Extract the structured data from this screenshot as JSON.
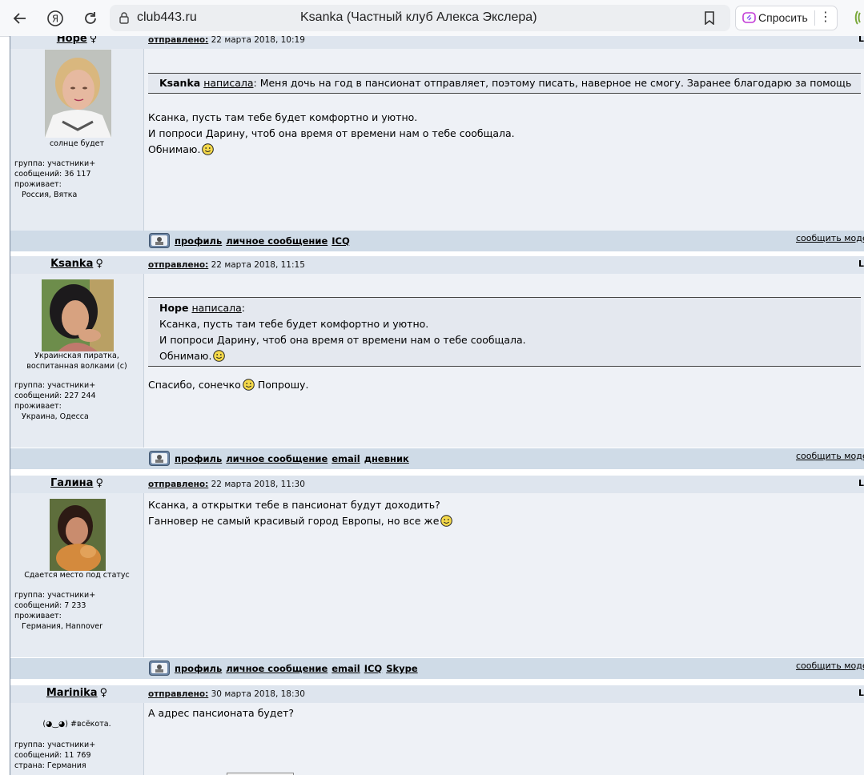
{
  "browser": {
    "url": "club443.ru",
    "page_title": "Ksanka (Частный клуб Алекса Экслера)",
    "ask_label": "Спросить"
  },
  "labels": {
    "sent": "отправлено:",
    "wrote": "написала",
    "report": "сообщить моде",
    "sex_symbol": "♀"
  },
  "posts": [
    {
      "user": "Hope",
      "date": "22 марта 2018, 10:19",
      "status": "солнце будет",
      "info": [
        "группа: участники+",
        "сообщений: 36 117",
        "проживает:",
        "   Россия, Вятка"
      ],
      "quote_author": "Ksanka",
      "quote_lines": [
        "Меня дочь на год в пансионат отправляет, поэтому писать, наверное не смогу. Заранее благодарю за помощь"
      ],
      "lines": [
        "Ксанка, пусть там тебе будет комфортно и уютно.",
        "И попроси Дарину, чтоб она время от времени нам о тебе сообщала.",
        "Обнимаю."
      ],
      "links": [
        "профиль",
        "личное сообщение",
        "ICQ"
      ]
    },
    {
      "user": "Ksanka",
      "date": "22 марта 2018, 11:15",
      "status_lines": [
        "Украинская пиратка,",
        "воспитанная волками (с)"
      ],
      "info": [
        "группа: участники+",
        "сообщений: 227 244",
        "проживает:",
        "   Украина, Одесса"
      ],
      "quote_author": "Hope",
      "quote_lines": [
        "Ксанка, пусть там тебе будет комфортно и уютно.",
        "И попроси Дарину, чтоб она время от времени нам о тебе сообщала.",
        "Обнимаю."
      ],
      "lines": [
        "Спасибо, сонечко",
        "Попрошу."
      ],
      "links": [
        "профиль",
        "личное сообщение",
        "email",
        "дневник"
      ]
    },
    {
      "user": "Галина",
      "date": "22 марта 2018, 11:30",
      "status": "Сдается место под статус",
      "info": [
        "группа: участники+",
        "сообщений: 7 233",
        "проживает:",
        "   Германия, Hannover"
      ],
      "lines": [
        "Ксанка, а открытки тебе в пансионат будут доходить?",
        "Ганновер не самый красивый город Европы, но все же"
      ],
      "links": [
        "профиль",
        "личное сообщение",
        "email",
        "ICQ",
        "Skype"
      ]
    },
    {
      "user": "Marinika",
      "date": "30 марта 2018, 18:30",
      "status": "(◕‿◕) #всёкота.",
      "info": [
        "группа: участники+",
        "сообщений: 11 769",
        "страна: Германия"
      ],
      "lines": [
        "А адрес пансионата будет?"
      ]
    }
  ],
  "colors": {
    "header_bg": "#dee5ee",
    "body_bg": "#eef1f6",
    "footer_bg": "#cfdbe7"
  }
}
